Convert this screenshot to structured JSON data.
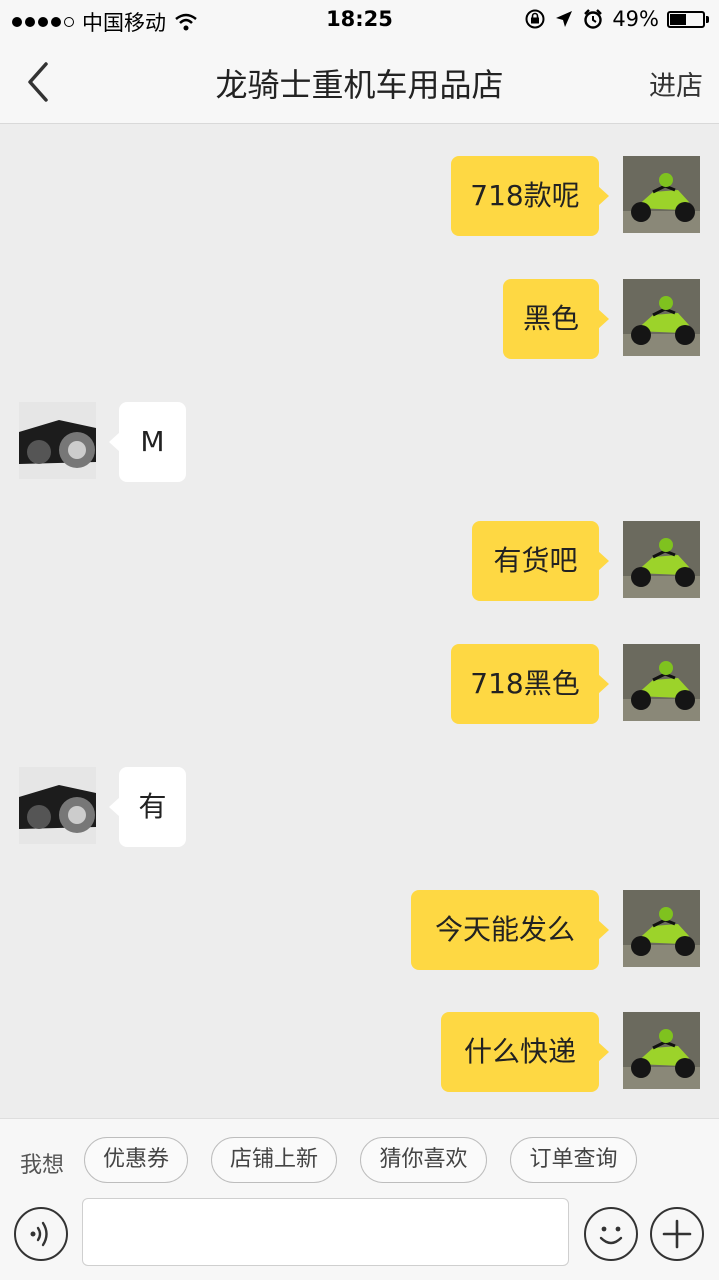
{
  "status_bar": {
    "carrier": "中国移动",
    "time": "18:25",
    "battery": "49%",
    "battery_level": 0.49,
    "icons": [
      "signal-dots-icon",
      "wifi-icon",
      "rotation-lock-icon",
      "location-arrow-icon",
      "alarm-icon",
      "battery-icon"
    ]
  },
  "nav": {
    "back_icon": "chevron-left-icon",
    "title": "龙骑士重机车用品店",
    "enter_label": "进店"
  },
  "messages": [
    {
      "side": "me",
      "text": "718款呢"
    },
    {
      "side": "me",
      "text": "黑色"
    },
    {
      "side": "other",
      "text": "M"
    },
    {
      "side": "me",
      "text": "有货吧"
    },
    {
      "side": "me",
      "text": "718黑色"
    },
    {
      "side": "other",
      "text": "有"
    },
    {
      "side": "me",
      "text": "今天能发么"
    },
    {
      "side": "me",
      "text": "什么快递"
    }
  ],
  "quick_bar": {
    "label": "我想",
    "chips": [
      "优惠券",
      "店铺上新",
      "猜你喜欢",
      "订单查询"
    ]
  },
  "composer": {
    "input_value": "",
    "voice_icon": "voice-icon",
    "emoji_icon": "emoji-icon",
    "plus_icon": "plus-icon"
  },
  "colors": {
    "my_bubble": "#fed843",
    "other_bubble": "#ffffff",
    "chat_background": "#ededed"
  }
}
